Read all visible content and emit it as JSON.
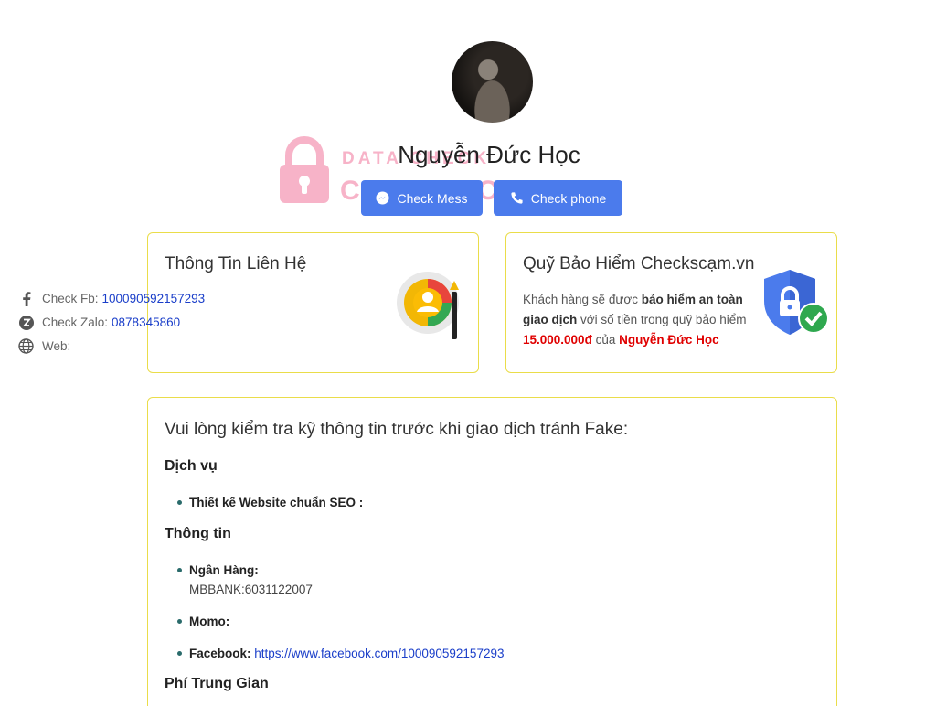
{
  "profile": {
    "name": "Nguyễn Đức Học",
    "watermark_top": "DATA CHECK",
    "watermark_bottom": "CHECKSCAM.VN"
  },
  "actions": {
    "mess_label": "Check Mess",
    "phone_label": "Check phone"
  },
  "contact": {
    "title": "Thông Tin Liên Hệ",
    "fb_label": "Check Fb:",
    "fb_value": "100090592157293",
    "zalo_label": "Check Zalo:",
    "zalo_value": "0878345860",
    "web_label": "Web:",
    "web_value": ""
  },
  "insurance": {
    "title": "Quỹ Bảo Hiểm Checkscạm.vn",
    "text_1": "Khách hàng sẽ được ",
    "text_bold": "bảo hiểm an toàn giao dịch",
    "text_2": " với số tiền trong quỹ bảo hiểm ",
    "amount": "15.000.000đ",
    "text_3": " của ",
    "name": "Nguyễn Đức Học"
  },
  "info": {
    "heading": "Vui lòng kiểm tra kỹ thông tin trước khi giao dịch tránh Fake:",
    "service_title": "Dịch vụ",
    "service_item": "Thiết kế Website chuẩn SEO :",
    "info_title": "Thông tin",
    "bank_label": "Ngân Hàng:",
    "bank_value": "MBBANK:6031122007",
    "momo_label": "Momo:",
    "facebook_label": "Facebook:",
    "facebook_value": "https://www.facebook.com/100090592157293",
    "fee_title": "Phí Trung Gian"
  },
  "colors": {
    "accent": "#4b7bec",
    "card_border": "#eadd4a",
    "link": "#1a3ec9",
    "warning_red": "#e00000",
    "watermark_pink": "#f7b3c8"
  }
}
